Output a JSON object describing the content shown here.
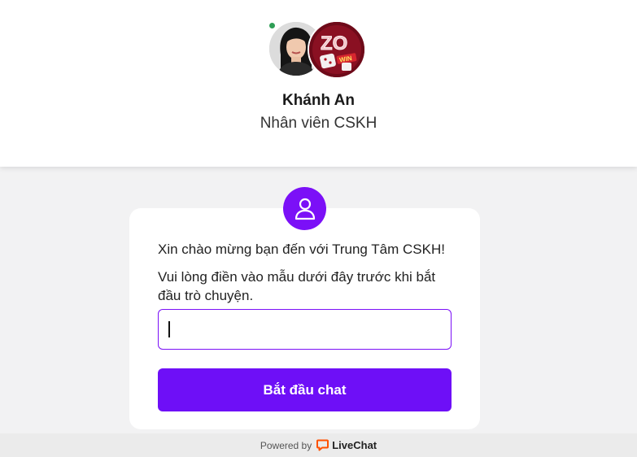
{
  "header": {
    "agent_name": "Khánh An",
    "agent_role": "Nhân viên CSKH",
    "agent_status": "online",
    "brand_logo_text": "ZO WIN"
  },
  "form": {
    "welcome_text": "Xin chào mừng bạn đến với Trung Tâm CSKH!",
    "instruction_text": "Vui lòng điền vào mẫu dưới đây trước khi bắt đầu trò chuyện.",
    "input_value": "",
    "input_placeholder": "",
    "submit_label": "Bắt đầu chat",
    "icon": "user-icon"
  },
  "footer": {
    "powered_by": "Powered by",
    "brand_name": "LiveChat",
    "brand_icon": "livechat-logo-icon"
  },
  "colors": {
    "accent": "#6e0ff7",
    "status_online": "#2e9e55",
    "livechat_orange": "#ff5100"
  }
}
